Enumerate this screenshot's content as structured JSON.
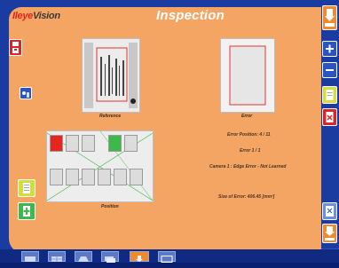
{
  "app": {
    "logo_brand": "Ileye",
    "logo_vision": "Vision",
    "title": "Inspection"
  },
  "images": {
    "reference_label": "Reference",
    "error_label": "Error",
    "position_label": "Position"
  },
  "info": {
    "error_position": "Error Position: 4 / 11",
    "error_count": "Error 1 / 1",
    "camera_status": "Camera 1 : Edge Error - Not Learned",
    "error_size": "Size of Error: 406.45 [mm²]"
  },
  "colors": {
    "panel": "#f4a563",
    "frame": "#1a3ca0",
    "error_cell": "#e5261f",
    "ok_cell": "#3cb94a",
    "accent_orange": "#f08a2c"
  },
  "icons": {
    "left": [
      "red-save-icon",
      "camera-settings-icon",
      "yellow-list-icon",
      "green-add-icon"
    ],
    "right": [
      "home-icon",
      "zoom-in-icon",
      "zoom-out-icon",
      "yellow-list-icon",
      "red-delete-icon",
      "help-icon",
      "home-active-icon",
      "back-icon"
    ],
    "bottom": [
      "grid-icon",
      "table-icon",
      "sheet-icon",
      "stack-icon",
      "inspection-icon",
      "window-icon"
    ]
  }
}
